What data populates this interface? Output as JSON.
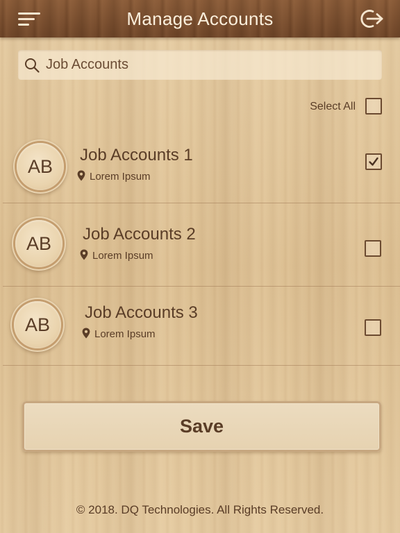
{
  "header": {
    "title": "Manage Accounts",
    "menu_icon": "hamburger-menu-icon",
    "logout_icon": "logout-icon"
  },
  "search": {
    "placeholder": "Job Accounts",
    "value": "",
    "icon": "search-icon"
  },
  "select_all": {
    "label": "Select All",
    "checked": false
  },
  "accounts": [
    {
      "initials": "AB",
      "name": "Job Accounts 1",
      "location": "Lorem Ipsum",
      "checked": true
    },
    {
      "initials": "AB",
      "name": "Job Accounts 2",
      "location": "Lorem Ipsum",
      "checked": false
    },
    {
      "initials": "AB",
      "name": "Job Accounts 3",
      "location": "Lorem Ipsum",
      "checked": false
    }
  ],
  "save_label": "Save",
  "footer": {
    "copyright": "© 2018. DQ Technologies. All Rights Reserved."
  },
  "colors": {
    "header_bg": "#7d5233",
    "header_text": "#fbefdc",
    "wood_bg": "#e2c79c",
    "text_primary": "#5a3d27"
  }
}
